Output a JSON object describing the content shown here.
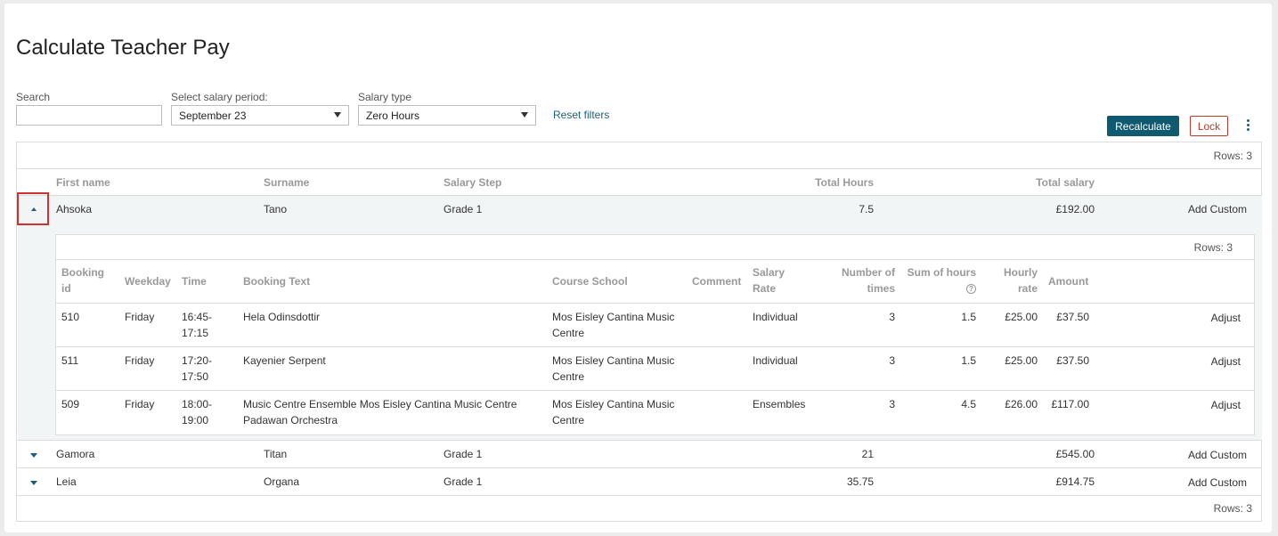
{
  "page": {
    "title": "Calculate Teacher Pay"
  },
  "filters": {
    "search_label": "Search",
    "search_value": "",
    "period_label": "Select salary period:",
    "period_value": "September 23",
    "type_label": "Salary type",
    "type_value": "Zero Hours",
    "reset_label": "Reset filters"
  },
  "actions": {
    "recalculate": "Recalculate",
    "lock": "Lock",
    "more_icon": "kebab-menu-icon"
  },
  "table": {
    "rows_count": "Rows: 3",
    "headers": {
      "first_name": "First name",
      "surname": "Surname",
      "salary_step": "Salary Step",
      "total_hours": "Total Hours",
      "total_salary": "Total salary"
    },
    "rows": [
      {
        "first_name": "Ahsoka",
        "surname": "Tano",
        "salary_step": "Grade 1",
        "total_hours": "7.5",
        "total_salary": "£192.00",
        "action": "Add Custom",
        "expanded": true
      },
      {
        "first_name": "Gamora",
        "surname": "Titan",
        "salary_step": "Grade 1",
        "total_hours": "21",
        "total_salary": "£545.00",
        "action": "Add Custom",
        "expanded": false
      },
      {
        "first_name": "Leia",
        "surname": "Organa",
        "salary_step": "Grade 1",
        "total_hours": "35.75",
        "total_salary": "£914.75",
        "action": "Add Custom",
        "expanded": false
      }
    ]
  },
  "detail": {
    "rows_count": "Rows: 3",
    "headers": {
      "booking_id_1": "Booking",
      "booking_id_2": "id",
      "weekday": "Weekday",
      "time": "Time",
      "booking_text": "Booking Text",
      "course_school": "Course School",
      "comment": "Comment",
      "salary_rate_1": "Salary",
      "salary_rate_2": "Rate",
      "number_of_times_1": "Number of",
      "number_of_times_2": "times",
      "sum_of_hours": "Sum of hours",
      "hourly_rate_1": "Hourly",
      "hourly_rate_2": "rate",
      "amount": "Amount"
    },
    "rows": [
      {
        "booking_id": "510",
        "weekday": "Friday",
        "time_1": "16:45-",
        "time_2": "17:15",
        "text_1": "Hela Odinsdottir",
        "text_2": "",
        "school_1": "Mos Eisley Cantina Music",
        "school_2": "Centre",
        "rate": "Individual",
        "times": "3",
        "hours": "1.5",
        "hourly": "£25.00",
        "amount": "£37.50",
        "action": "Adjust"
      },
      {
        "booking_id": "511",
        "weekday": "Friday",
        "time_1": "17:20-",
        "time_2": "17:50",
        "text_1": "Kayenier Serpent",
        "text_2": "",
        "school_1": "Mos Eisley Cantina Music",
        "school_2": "Centre",
        "rate": "Individual",
        "times": "3",
        "hours": "1.5",
        "hourly": "£25.00",
        "amount": "£37.50",
        "action": "Adjust"
      },
      {
        "booking_id": "509",
        "weekday": "Friday",
        "time_1": "18:00-",
        "time_2": "19:00",
        "text_1": "Music Centre Ensemble Mos Eisley Cantina Music Centre",
        "text_2": "Padawan Orchestra",
        "school_1": "Mos Eisley Cantina Music",
        "school_2": "Centre",
        "rate": "Ensembles",
        "times": "3",
        "hours": "4.5",
        "hourly": "£26.00",
        "amount": "£117.00",
        "action": "Adjust"
      }
    ]
  },
  "rows_footer": "Rows: 3"
}
